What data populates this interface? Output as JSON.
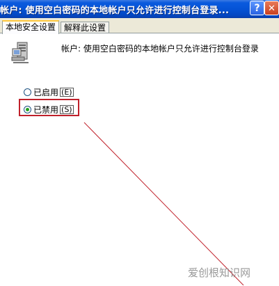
{
  "window": {
    "title": "帐户: 使用空白密码的本地帐户只允许进行控制台登录...",
    "help_label": "?",
    "close_label": "✕"
  },
  "tabs": [
    {
      "label": "本地安全设置",
      "active": true
    },
    {
      "label": "解释此设置",
      "active": false
    }
  ],
  "policy": {
    "icon": "server-icon",
    "description": "帐户: 使用空白密码的本地帐户只允许进行控制台登录"
  },
  "options": [
    {
      "label": "已启用",
      "hotkey": "E",
      "checked": false
    },
    {
      "label": "已禁用",
      "hotkey": "S",
      "checked": true
    }
  ],
  "annotation": {
    "highlight_color": "#c0202a",
    "line_color": "#c0202a"
  },
  "watermark": "爱创根知识网"
}
